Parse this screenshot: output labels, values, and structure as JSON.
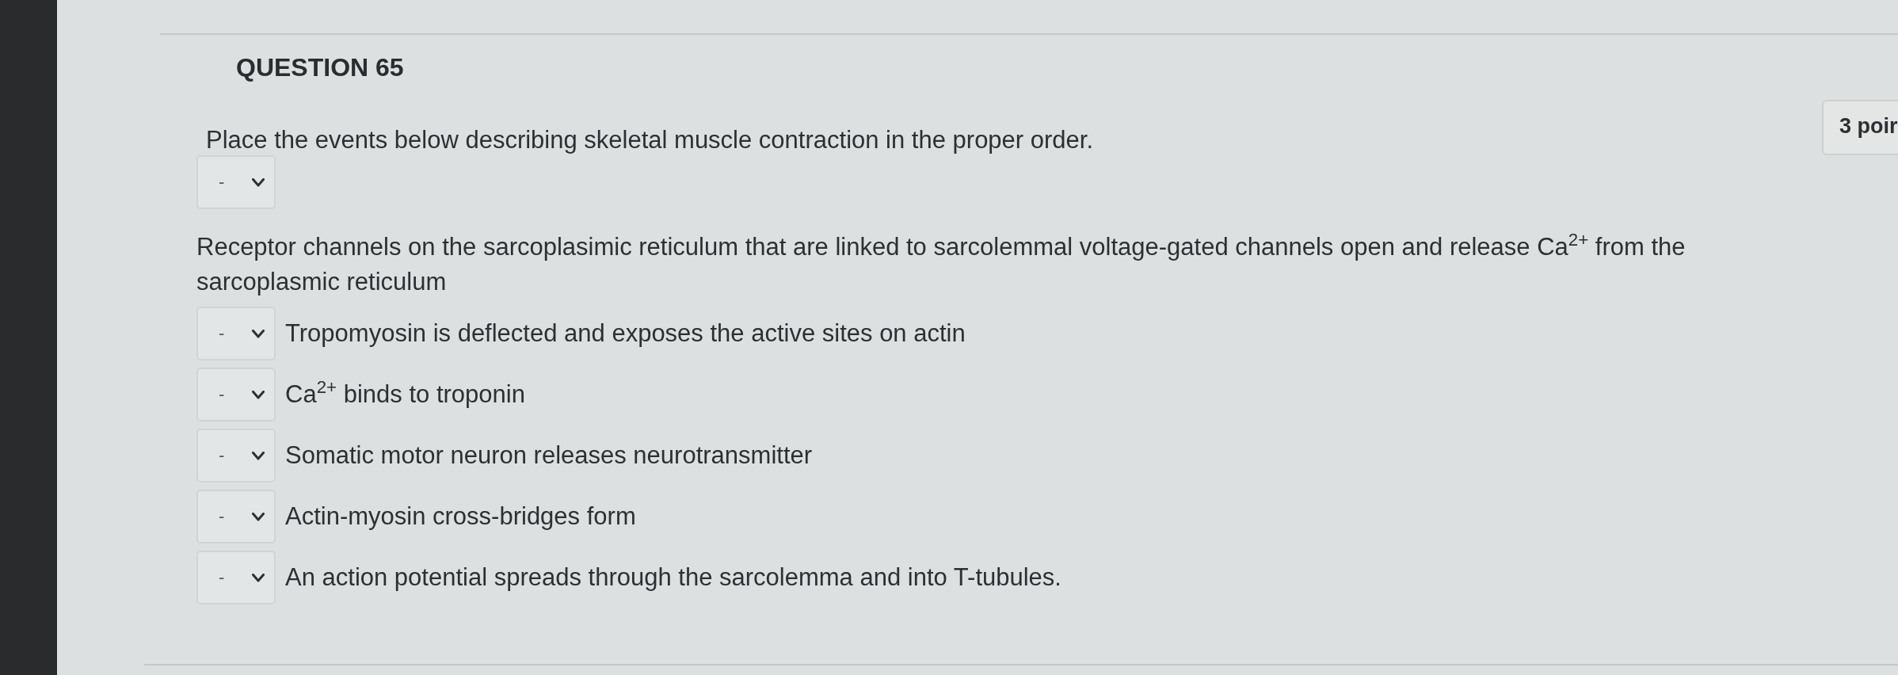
{
  "question": {
    "title": "QUESTION 65",
    "points": "3 poir",
    "prompt": "Place the events below describing skeletal muscle contraction in the proper order."
  },
  "events": [
    {
      "answer": "-",
      "text": "Receptor channels on the sarcoplasimic reticulum that are linked to sarcolemmal voltage-gated channels open and release Ca$^{2+}$ from the sarcoplasmic reticulum"
    },
    {
      "answer": "-",
      "text": "Tropomyosin is deflected and exposes the active sites on actin"
    },
    {
      "answer": "-",
      "text": "Ca$^{2+}$ binds to troponin"
    },
    {
      "answer": "-",
      "text": "Somatic motor neuron releases neurotransmitter"
    },
    {
      "answer": "-",
      "text": "Actin-myosin cross-bridges form"
    },
    {
      "answer": "-",
      "text": "An action potential spreads through the sarcolemma and into T-tubules."
    }
  ]
}
